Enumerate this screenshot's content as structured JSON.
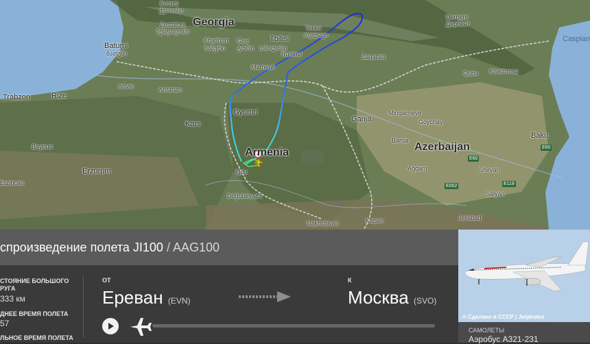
{
  "map": {
    "countries": [
      "Georgia",
      "Armenia",
      "Azerbaijan"
    ],
    "sea": "Caspian",
    "cities": [
      "Kutaisi",
      "ქუთაისი",
      "Zestafoni",
      "ზესტაფონი",
      "Batumi",
      "ბათუმი",
      "Khashuri",
      "ხაშური",
      "Gori",
      "გორი",
      "Tbilisi",
      "თბილისი",
      "Telavi",
      "თელავი",
      "Rustavi",
      "Marneuli",
      "Artvin",
      "Ardahan",
      "Rize",
      "Trabzon",
      "Gyumri",
      "Kars",
      "Bayburt",
      "Erzurum",
      "Erzincan",
      "Iğdır",
      "Doğubeyazıt",
      "Ganja",
      "Mingachevir",
      "Goychay",
      "Barda",
      "Shirvan",
      "Salyan",
      "Baku",
      "Khachmaz",
      "Quba",
      "Zaqatala",
      "Derbent",
      "Дербент",
      "Nakhchivan",
      "Kapan",
      "Jeilabad",
      "Agdam"
    ],
    "roads": [
      "E60",
      "E002",
      "E119",
      "E60"
    ],
    "track_color_start": "#3ec7ff",
    "track_color_end": "#1f2bd8"
  },
  "header": {
    "title_main": "спроизведение полета JI100",
    "separator": " / ",
    "title_alt": "AAG100"
  },
  "stats": {
    "distance_label": "СТОЯНИЕ БОЛЬШОГО\nРУГА",
    "distance_value": "333 км",
    "avg_time_label": "ДНЕЕ ВРЕМЯ ПОЛЕТА",
    "avg_time_value": "57",
    "total_time_label": "ЛЬНОЕ ВРЕМЯ ПОЛЕТА"
  },
  "route": {
    "from_label": "ОТ",
    "from_city": "Ереван",
    "from_code": "(EVN)",
    "to_label": "К",
    "to_city": "Москва",
    "to_code": "(SVO)"
  },
  "photo": {
    "credit": "© Сделано в СССР | Jetphotos"
  },
  "aircraft": {
    "label": "САМОЛЕТЫ",
    "value": "Аэробус A321-231"
  }
}
